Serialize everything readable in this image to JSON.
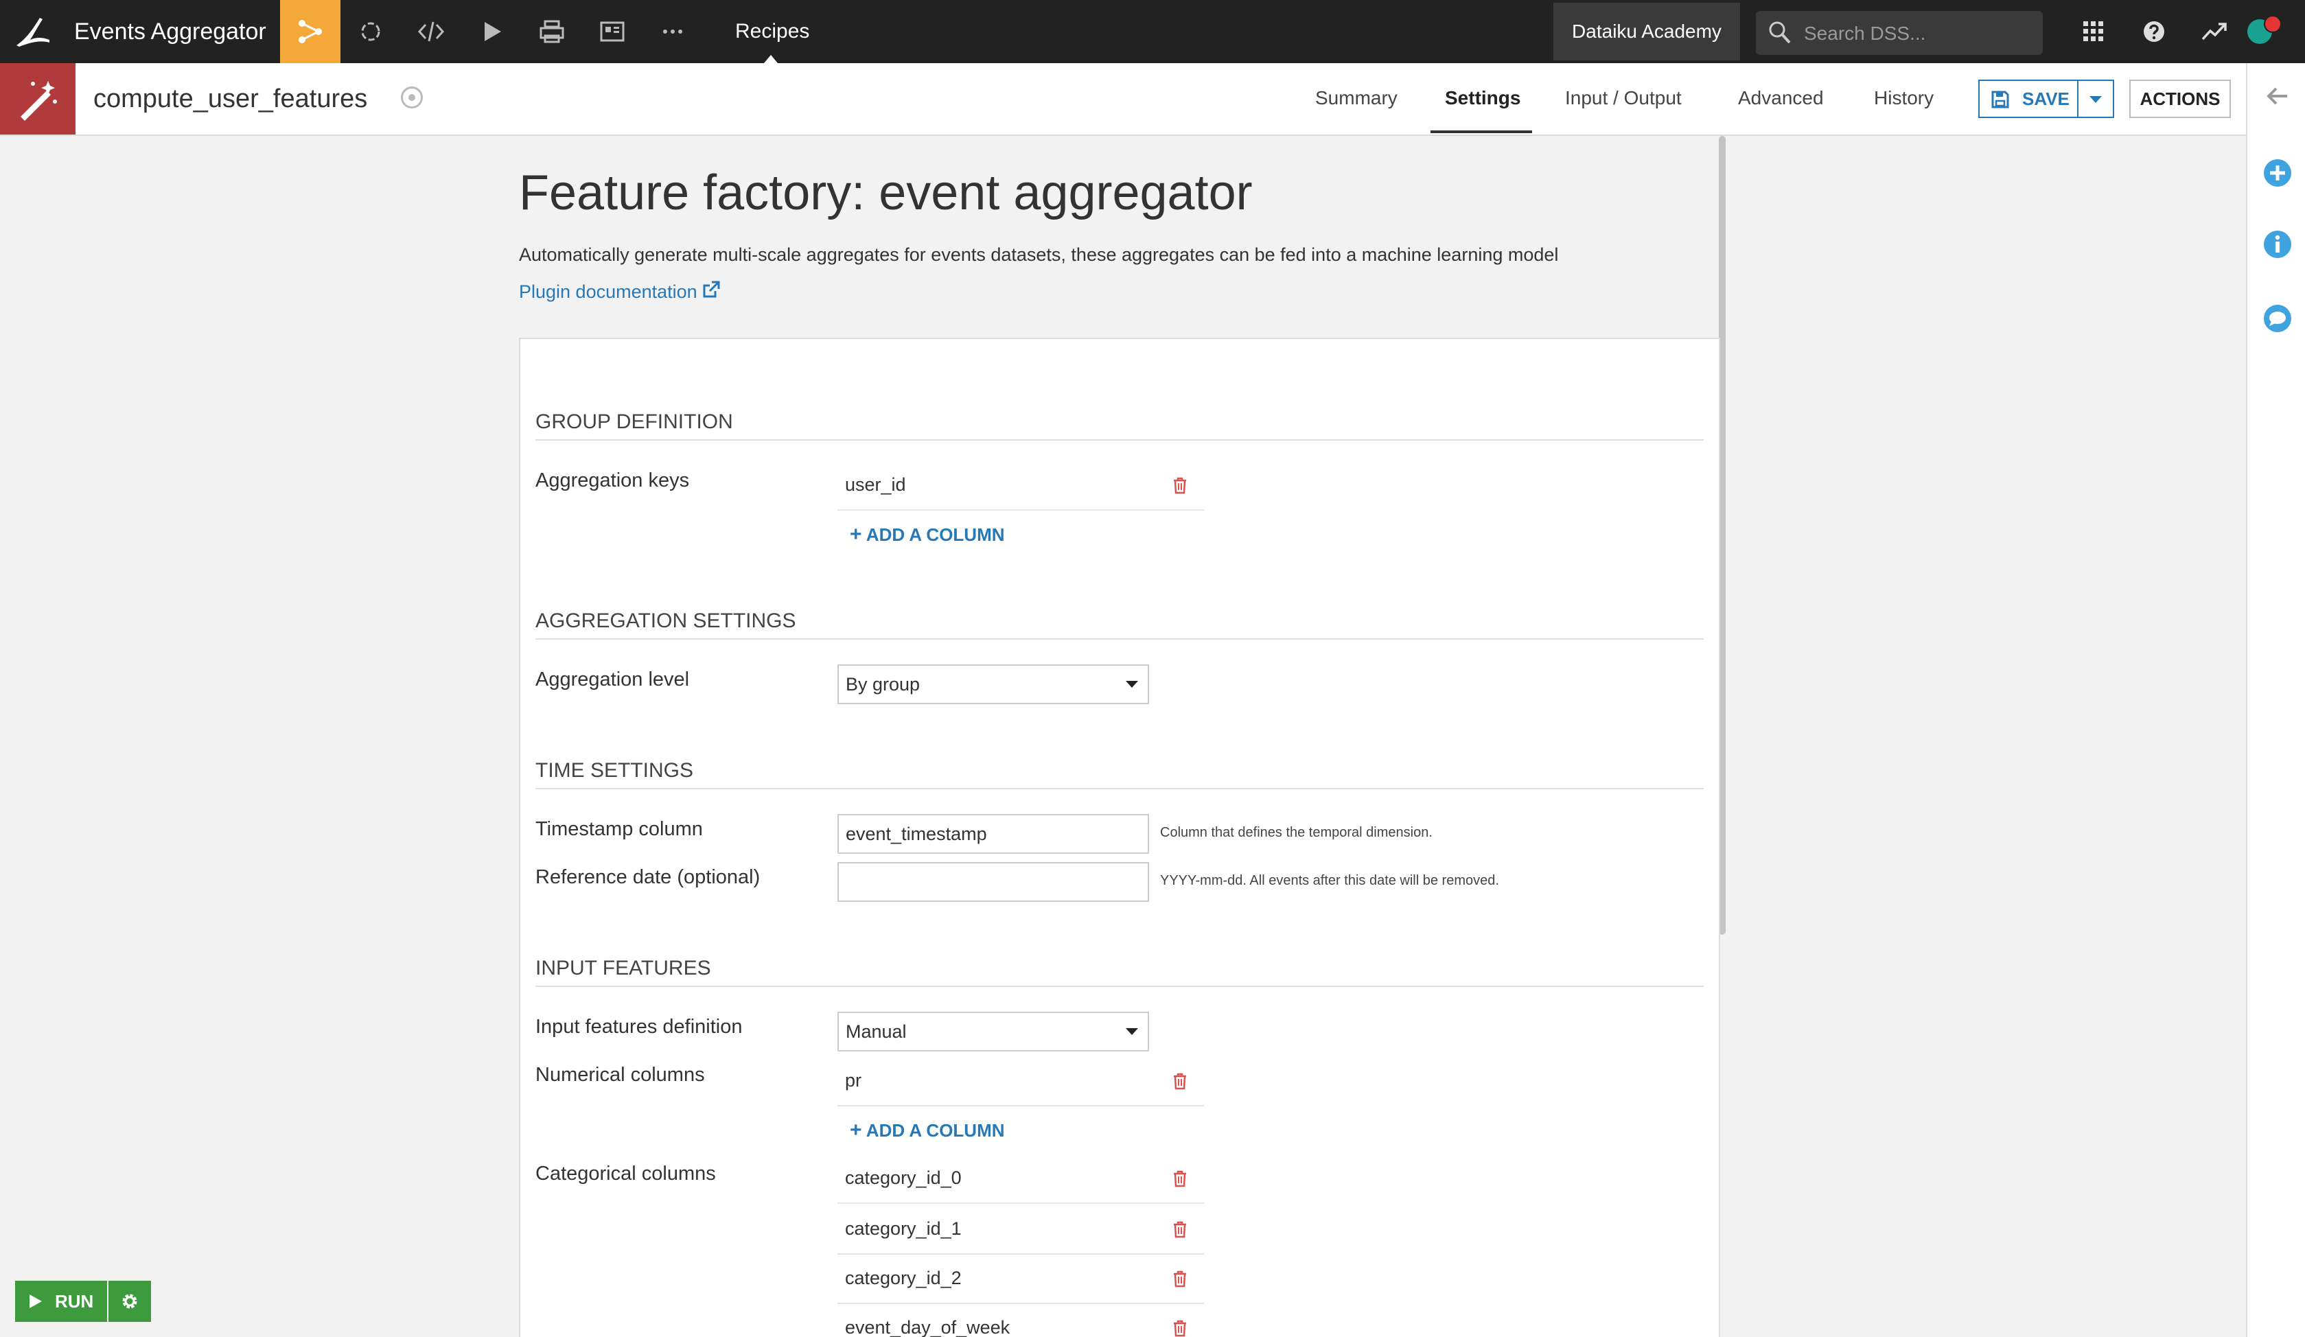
{
  "topnav": {
    "project_name": "Events Aggregator",
    "recipes_label": "Recipes",
    "academy_label": "Dataiku Academy",
    "search_placeholder": "Search DSS..."
  },
  "recipe": {
    "name": "compute_user_features",
    "tabs": [
      "Summary",
      "Settings",
      "Input / Output",
      "Advanced",
      "History"
    ],
    "active_tab": "Settings",
    "save_label": "SAVE",
    "actions_label": "ACTIONS"
  },
  "page": {
    "title": "Feature factory: event aggregator",
    "description": "Automatically generate multi-scale aggregates for events datasets, these aggregates can be fed into a machine learning model",
    "doc_link": "Plugin documentation"
  },
  "form": {
    "add_column_label": "ADD A COLUMN",
    "group_definition": {
      "title": "GROUP DEFINITION",
      "aggregation_keys_label": "Aggregation keys",
      "aggregation_keys": [
        "user_id"
      ]
    },
    "aggregation_settings": {
      "title": "AGGREGATION SETTINGS",
      "aggregation_level_label": "Aggregation level",
      "aggregation_level": "By group"
    },
    "time_settings": {
      "title": "TIME SETTINGS",
      "timestamp_label": "Timestamp column",
      "timestamp_value": "event_timestamp",
      "timestamp_help": "Column that defines the temporal dimension.",
      "refdate_label": "Reference date (optional)",
      "refdate_value": "",
      "refdate_help": "YYYY-mm-dd. All events after this date will be removed."
    },
    "input_features": {
      "title": "INPUT FEATURES",
      "definition_label": "Input features definition",
      "definition_value": "Manual",
      "numerical_label": "Numerical columns",
      "numerical_columns": [
        "pr"
      ],
      "categorical_label": "Categorical columns",
      "categorical_columns": [
        "category_id_0",
        "category_id_1",
        "category_id_2",
        "event_day_of_week"
      ]
    }
  },
  "run": {
    "label": "RUN"
  },
  "colors": {
    "topbar": "#222222",
    "flow_accent": "#f5a83a",
    "recipe_icon_bg": "#b13b3b",
    "link_blue": "#2678b6",
    "run_green": "#3d9a3d",
    "trash_red": "#d9534f",
    "sidebar_icon_blue": "#3fa3e0"
  }
}
